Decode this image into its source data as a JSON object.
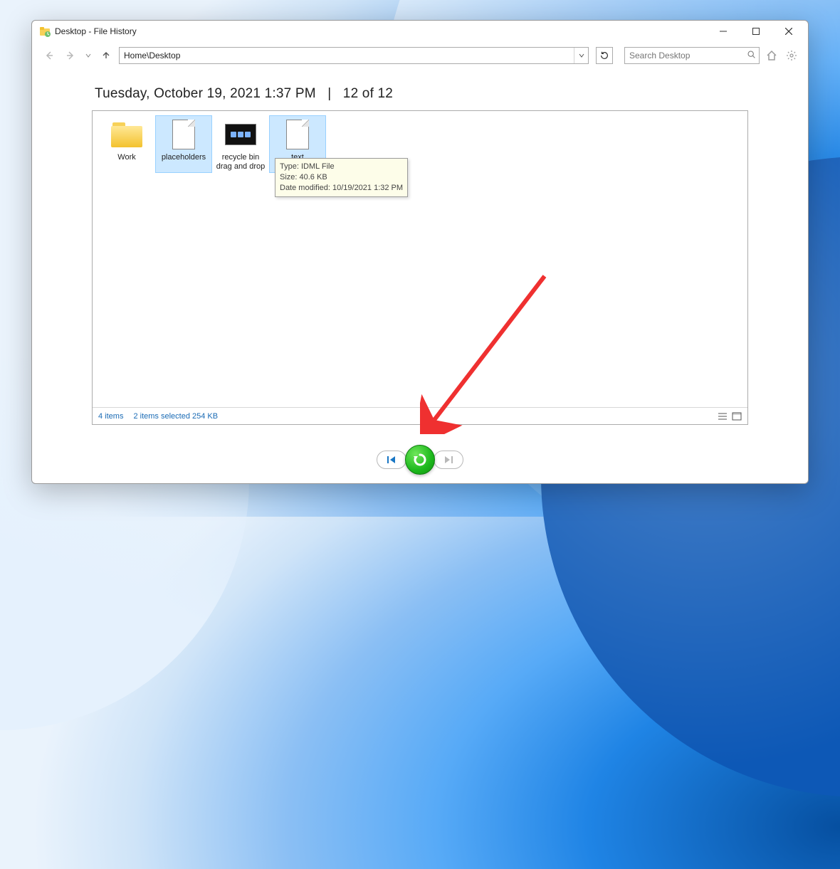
{
  "window": {
    "title": "Desktop - File History"
  },
  "toolbar": {
    "path": "Home\\Desktop",
    "search_placeholder": "Search Desktop"
  },
  "heading": {
    "timestamp": "Tuesday, October 19, 2021 1:37 PM",
    "separator": "|",
    "position": "12 of 12"
  },
  "items": [
    {
      "name": "Work",
      "type": "folder",
      "selected": false
    },
    {
      "name": "placeholders",
      "type": "file",
      "selected": true
    },
    {
      "name": "recycle bin drag and drop",
      "type": "image",
      "selected": false
    },
    {
      "name": "text",
      "type": "file",
      "selected": true
    }
  ],
  "tooltip": {
    "line1": "Type: IDML File",
    "line2": "Size: 40.6 KB",
    "line3": "Date modified: 10/19/2021 1:32 PM"
  },
  "status": {
    "count": "4 items",
    "selection": "2 items selected  254 KB"
  }
}
